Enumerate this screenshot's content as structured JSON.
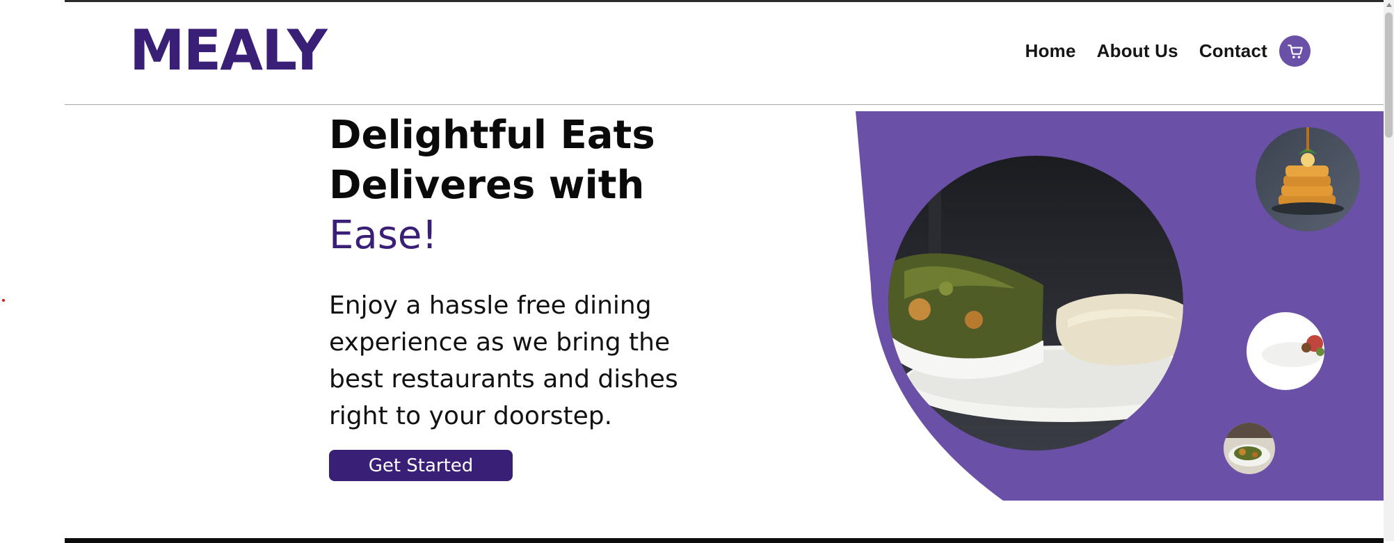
{
  "brand": {
    "name": "MEALY"
  },
  "nav": {
    "links": [
      "Home",
      "About Us",
      "Contact"
    ],
    "cart_icon": "cart-icon"
  },
  "hero": {
    "headline_line1": "Delightful Eats",
    "headline_line2": "Deliveres with",
    "headline_accent": "Ease!",
    "subtext": "Enjoy a hassle free dining experience as we bring the best restaurants and dishes right to your doorstep.",
    "cta_label": "Get Started",
    "images": {
      "main": "food-plate-image",
      "top_small": "pancakes-image",
      "mid_small": "plated-dish-image",
      "bottom_small": "restaurant-meal-image"
    }
  },
  "colors": {
    "brand_purple": "#3a1f77",
    "panel_purple": "#6a50a7",
    "nav_text": "#151515",
    "divider": "#a9a9a9"
  }
}
